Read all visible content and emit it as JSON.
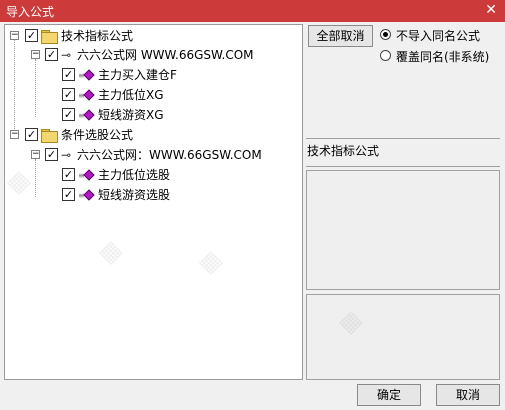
{
  "window": {
    "title": "导入公式",
    "close_label": "✕"
  },
  "tree": {
    "groups": [
      {
        "label": "技术指标公式",
        "site": "六六公式网 WWW.66GSW.COM",
        "items": [
          "主力买入建仓F",
          "主力低位XG",
          "短线游资XG"
        ]
      },
      {
        "label": "条件选股公式",
        "site": "六六公式网：WWW.66GSW.COM",
        "items": [
          "主力低位选股",
          "短线游资选股"
        ]
      }
    ]
  },
  "right": {
    "cancel_all": "全部取消",
    "options": [
      "不导入同名公式",
      "覆盖同名(非系统)"
    ],
    "selected_index": 0,
    "section_title": "技术指标公式"
  },
  "footer": {
    "ok": "确定",
    "cancel": "取消"
  }
}
